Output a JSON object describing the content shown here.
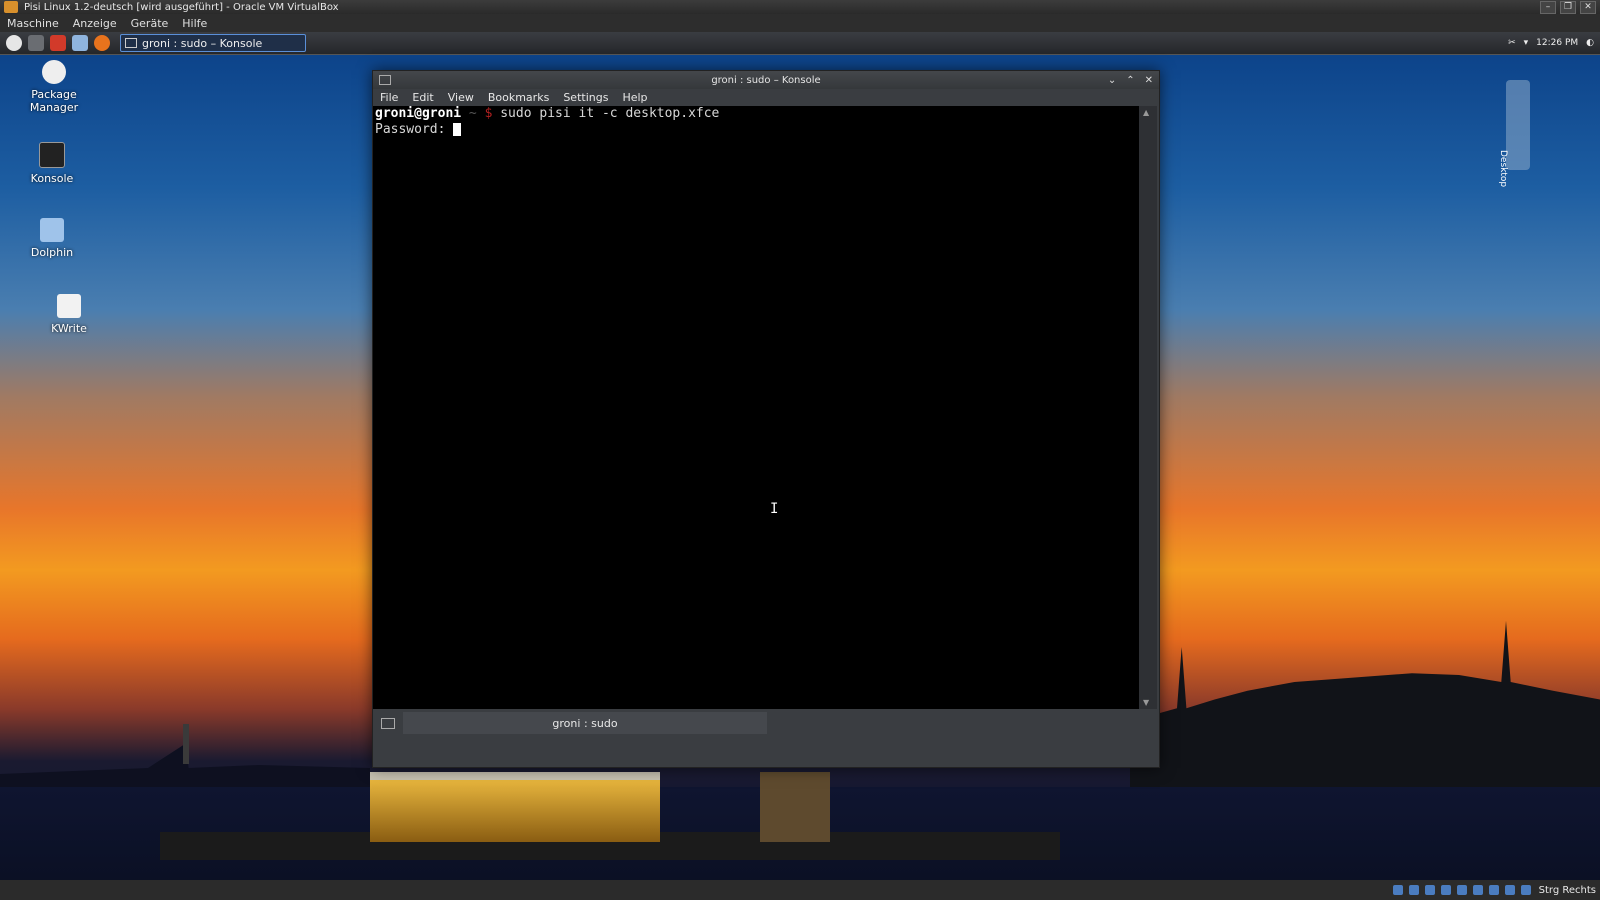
{
  "host": {
    "title": "Pisi Linux 1.2-deutsch [wird ausgeführt] - Oracle VM VirtualBox",
    "menus": [
      "Maschine",
      "Anzeige",
      "Geräte",
      "Hilfe"
    ],
    "window_buttons": [
      "minimize-icon",
      "restore-icon",
      "close-icon"
    ],
    "status_hostkey": "Strg Rechts"
  },
  "taskbar": {
    "task_label": "groni : sudo – Konsole",
    "clock": "12:26 PM"
  },
  "desktop_icons": [
    {
      "label": "Package Manager",
      "icon": "package-manager-icon"
    },
    {
      "label": "Konsole",
      "icon": "konsole-icon"
    },
    {
      "label": "Dolphin",
      "icon": "dolphin-icon"
    },
    {
      "label": "KWrite",
      "icon": "kwrite-icon"
    }
  ],
  "side_tab": {
    "label": "Desktop"
  },
  "konsole": {
    "title": "groni : sudo – Konsole",
    "menus": [
      "File",
      "Edit",
      "View",
      "Bookmarks",
      "Settings",
      "Help"
    ],
    "prompt_user": "groni@groni",
    "prompt_path": " ~ ",
    "prompt_symbol": "$",
    "command": " sudo pisi it -c desktop.xfce",
    "password_prompt": "Password: ",
    "tab_label": "groni : sudo"
  },
  "colors": {
    "taskbar_accent": "#5a8fd8",
    "prompt_symbol": "#b02020"
  }
}
